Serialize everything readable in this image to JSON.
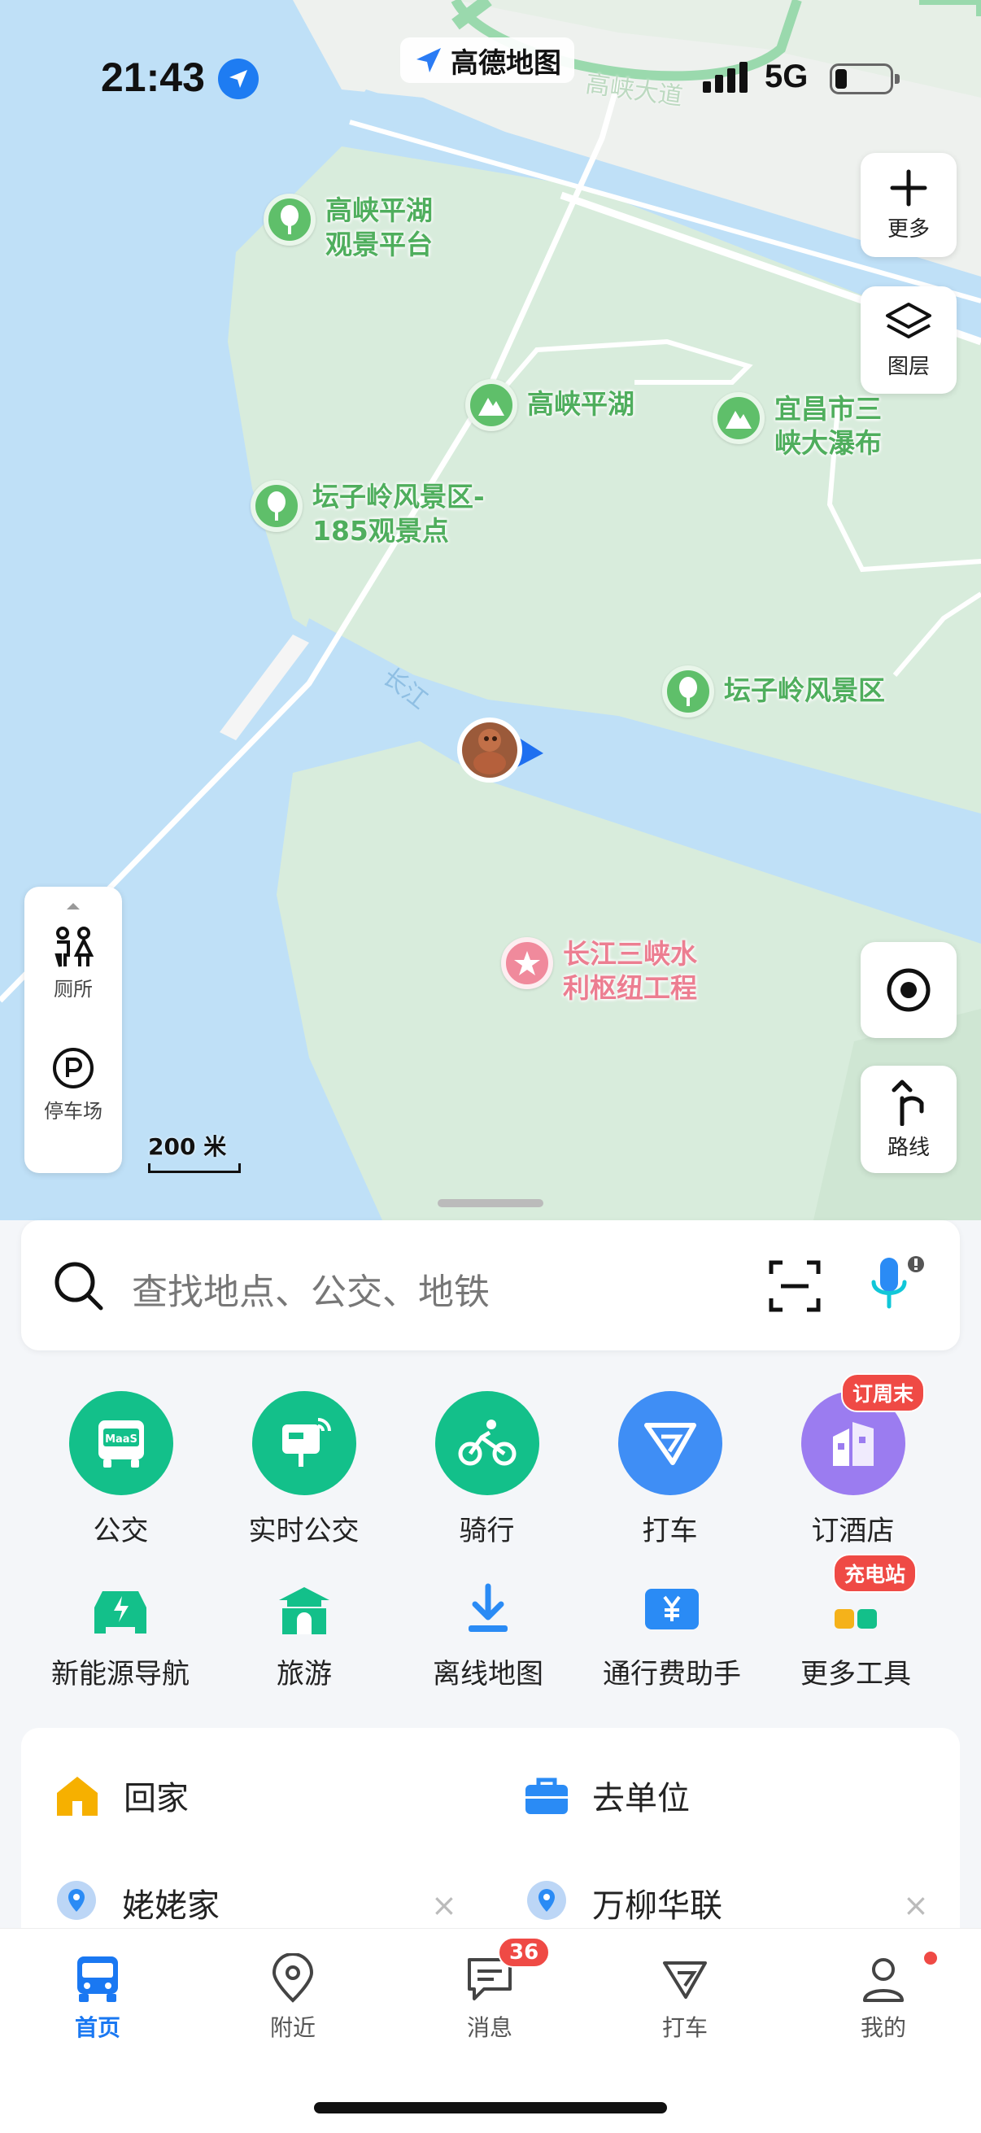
{
  "status_bar": {
    "time": "21:43",
    "network": "5G",
    "app_badge": "高德地图"
  },
  "map": {
    "road_label": "高峡大道",
    "river_label": "长江",
    "scale": "200 米",
    "pois": [
      {
        "name": "高峡平湖\n观景平台",
        "kind": "park"
      },
      {
        "name": "高峡平湖",
        "kind": "mountain"
      },
      {
        "name": "宜昌市三\n峡大瀑布",
        "kind": "mountain"
      },
      {
        "name": "坛子岭风景区-\n185观景点",
        "kind": "park"
      },
      {
        "name": "坛子岭风景区",
        "kind": "park"
      },
      {
        "name": "长江三峡水\n利枢纽工程",
        "kind": "landmark"
      }
    ],
    "right_buttons": {
      "more": "更多",
      "layers": "图层",
      "route": "路线"
    },
    "left_panel": {
      "toilet": "厕所",
      "parking": "停车场"
    }
  },
  "search": {
    "placeholder": "查找地点、公交、地铁"
  },
  "quick_actions": [
    {
      "label": "公交",
      "color": "#13c08a",
      "badge": ""
    },
    {
      "label": "实时公交",
      "color": "#13c08a",
      "badge": ""
    },
    {
      "label": "骑行",
      "color": "#13c08a",
      "badge": ""
    },
    {
      "label": "打车",
      "color": "#3f8ef5",
      "badge": ""
    },
    {
      "label": "订酒店",
      "color": "#9b7cf0",
      "badge": "订周末"
    }
  ],
  "tools": [
    {
      "label": "新能源导航",
      "badge": ""
    },
    {
      "label": "旅游",
      "badge": ""
    },
    {
      "label": "离线地图",
      "badge": ""
    },
    {
      "label": "通行费助手",
      "badge": ""
    },
    {
      "label": "更多工具",
      "badge": "充电站"
    }
  ],
  "favorites": {
    "home": "回家",
    "work": "去单位",
    "saved": [
      "姥姥家",
      "万柳华联"
    ]
  },
  "tabbar": {
    "tabs": [
      "首页",
      "附近",
      "消息",
      "打车",
      "我的"
    ],
    "message_count": "36",
    "active": "首页"
  },
  "colors": {
    "accent_blue": "#1a78f2",
    "green": "#13c08a",
    "badge_red": "#ef4a45"
  }
}
